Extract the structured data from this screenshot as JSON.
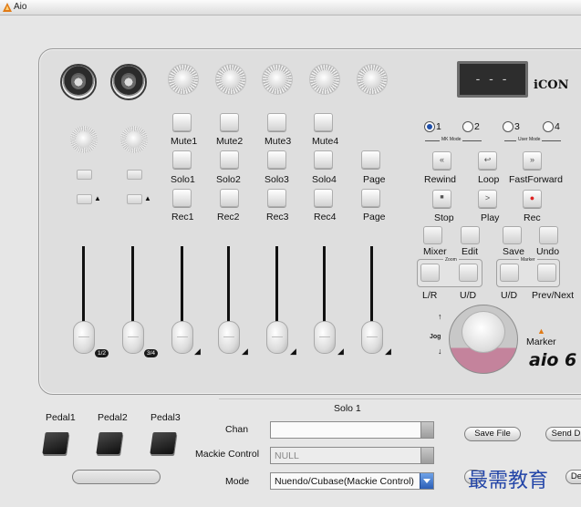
{
  "window": {
    "title": "Aio"
  },
  "display": {
    "text": "- - -"
  },
  "brand": {
    "logo": "iCON",
    "model_logo": "aio 6"
  },
  "channels": {
    "mute": [
      "Mute1",
      "Mute2",
      "Mute3",
      "Mute4"
    ],
    "solo": [
      "Solo1",
      "Solo2",
      "Solo3",
      "Solo4"
    ],
    "rec": [
      "Rec1",
      "Rec2",
      "Rec3",
      "Rec4"
    ],
    "page": [
      "Page",
      "Page"
    ],
    "fader_tags": [
      "1/2",
      "3/4"
    ]
  },
  "mode_radios": {
    "options": [
      "1",
      "2",
      "3",
      "4"
    ],
    "selected": "1",
    "mk_mode": "MK Mode",
    "user_mode": "User Mode"
  },
  "transport": {
    "rewind": "Rewind",
    "loop": "Loop",
    "fastforward": "FastForward",
    "stop": "Stop",
    "play": "Play",
    "rec": "Rec",
    "mixer": "Mixer",
    "edit": "Edit",
    "save": "Save",
    "undo": "Undo",
    "zoom": "Zoom",
    "marker_group": "Marker",
    "lr": "L/R",
    "ud1": "U/D",
    "ud2": "U/D",
    "prevnext": "Prev/Next",
    "jog": "Jog",
    "marker": "Marker"
  },
  "pedals": [
    "Pedal1",
    "Pedal2",
    "Pedal3"
  ],
  "settings": {
    "section_title": "Solo 1",
    "chan_label": "Chan",
    "chan_value": "",
    "mackie_label": "Mackie Control",
    "mackie_value": "NULL",
    "mode_label": "Mode",
    "mode_value": "Nuendo/Cubase(Mackie Control)"
  },
  "buttons": {
    "save_file": "Save File",
    "send": "Send D",
    "de": "De"
  },
  "watermark": "最需教育",
  "colors": {
    "accent": "#c4839c",
    "selection": "#1f4ea8"
  }
}
